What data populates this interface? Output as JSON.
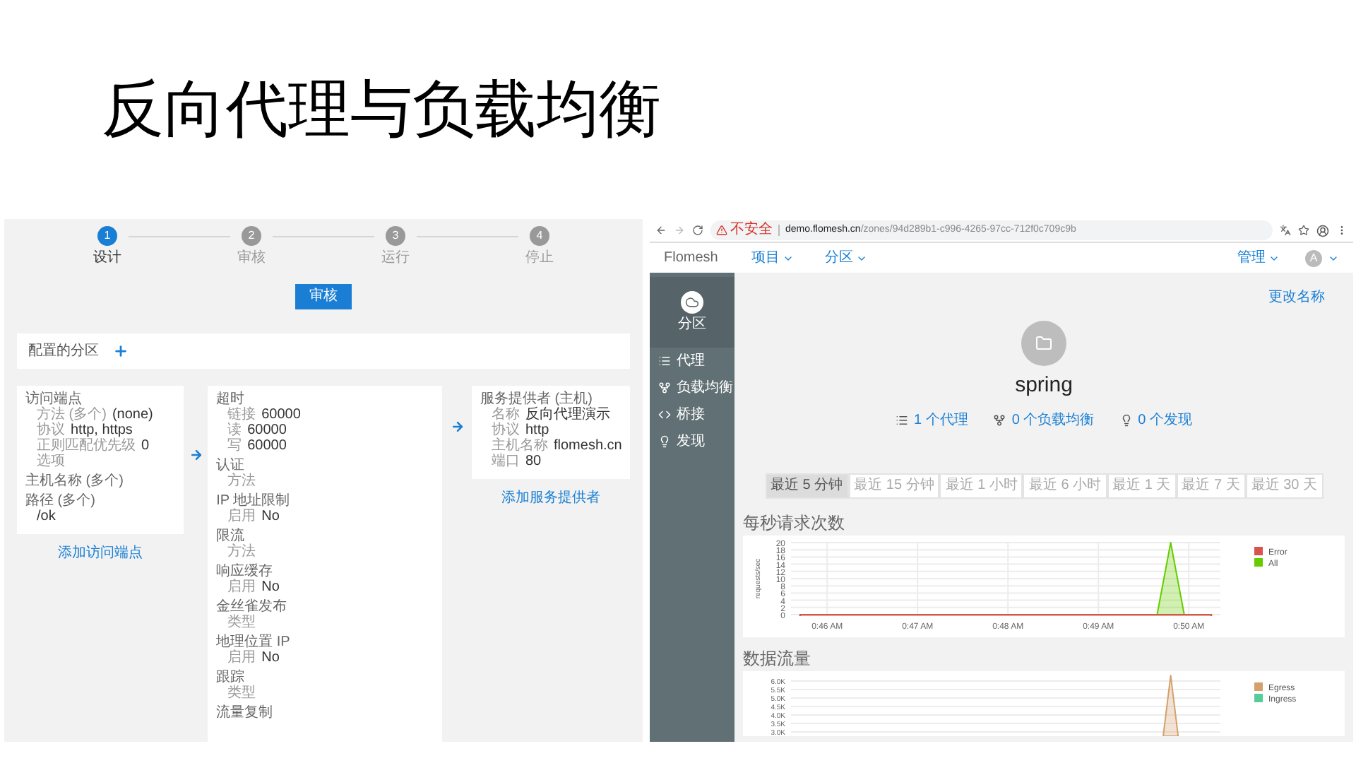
{
  "slide_title": "反向代理与负载均衡",
  "designer": {
    "steps": [
      {
        "number": "1",
        "label": "设计",
        "selected": true
      },
      {
        "number": "2",
        "label": "审核",
        "selected": false
      },
      {
        "number": "3",
        "label": "运行",
        "selected": false
      },
      {
        "number": "4",
        "label": "停止",
        "selected": false
      }
    ],
    "submit_button": "审核",
    "partition_bar": {
      "label": "配置的分区"
    },
    "entry_card": {
      "sections": [
        {
          "title": "访问端点",
          "rows": [
            {
              "label": "方法 (多个)",
              "value": "(none)"
            },
            {
              "label": "协议",
              "value": "http, https"
            },
            {
              "label": "正则匹配优先级",
              "value": "0"
            },
            {
              "label": "选项"
            }
          ]
        },
        {
          "title": "主机名称 (多个)"
        },
        {
          "title": "路径 (多个)",
          "rows": [
            {
              "value": "/ok"
            }
          ]
        }
      ]
    },
    "add_entry_link": "添加访问端点",
    "policy_card": {
      "sections": [
        {
          "title": "超时",
          "rows": [
            {
              "label": "链接",
              "value": "60000"
            },
            {
              "label": "读",
              "value": "60000"
            },
            {
              "label": "写",
              "value": "60000"
            }
          ]
        },
        {
          "title": "认证",
          "rows": [
            {
              "label": "方法"
            }
          ]
        },
        {
          "title": "IP 地址限制",
          "rows": [
            {
              "label": "启用",
              "value": "No"
            }
          ]
        },
        {
          "title": "限流",
          "rows": [
            {
              "label": "方法"
            }
          ]
        },
        {
          "title": "响应缓存",
          "rows": [
            {
              "label": "启用",
              "value": "No"
            }
          ]
        },
        {
          "title": "金丝雀发布",
          "rows": [
            {
              "label": "类型"
            }
          ]
        },
        {
          "title": "地理位置 IP",
          "rows": [
            {
              "label": "启用",
              "value": "No"
            }
          ]
        },
        {
          "title": "跟踪",
          "rows": [
            {
              "label": "类型"
            }
          ]
        },
        {
          "title": "流量复制"
        }
      ]
    },
    "provider_card": {
      "sections": [
        {
          "title": "服务提供者 (主机)",
          "rows": [
            {
              "label": "名称",
              "value": "反向代理演示"
            },
            {
              "label": "协议",
              "value": "http"
            },
            {
              "label": "主机名称",
              "value": "flomesh.cn"
            },
            {
              "label": "端口",
              "value": "80"
            }
          ]
        }
      ]
    },
    "add_provider_link": "添加服务提供者"
  },
  "browser": {
    "address_bar": {
      "security_label": "不安全",
      "host": "demo.flomesh.cn",
      "path": "/zones/94d289b1-c996-4265-97cc-712f0c709c9b"
    },
    "navbar": {
      "brand": "Flomesh",
      "menus": [
        "项目",
        "分区"
      ],
      "admin_menu": "管理",
      "avatar": "A"
    },
    "sidebar": {
      "header": "分区",
      "items": [
        "代理",
        "负载均衡",
        "桥接",
        "发现"
      ]
    },
    "rename_link": "更改名称",
    "zone_name": "spring",
    "stats": [
      "1 个代理",
      "0 个负载均衡",
      "0 个发现"
    ],
    "time_ranges": [
      {
        "label": "最近 5 分钟",
        "selected": true
      },
      {
        "label": "最近 15 分钟",
        "selected": false
      },
      {
        "label": "最近 1 小时",
        "selected": false
      },
      {
        "label": "最近 6 小时",
        "selected": false
      },
      {
        "label": "最近 1 天",
        "selected": false
      },
      {
        "label": "最近 7 天",
        "selected": false
      },
      {
        "label": "最近 30 天",
        "selected": false
      }
    ],
    "requests_panel": {
      "title": "每秒请求次数",
      "chart_data": {
        "type": "area",
        "grid": true,
        "legend": true,
        "ylabel": "requests/sec",
        "x": [
          45.7,
          46,
          46.5,
          47,
          47.5,
          48,
          48.5,
          49,
          49.5,
          49.65,
          49.8,
          49.95,
          50.25
        ],
        "series": [
          {
            "name": "Error",
            "color": "#d9534f",
            "values": [
              0,
              0,
              0,
              0,
              0,
              0,
              0,
              0,
              0,
              0,
              0,
              0,
              0
            ]
          },
          {
            "name": "All",
            "color": "#66cc00",
            "values": [
              0,
              0,
              0,
              0,
              0,
              0,
              0,
              0,
              0,
              0,
              20,
              0,
              0
            ]
          }
        ],
        "xlim": [
          45.6,
          50.35
        ],
        "ylim": [
          0,
          20
        ],
        "xticks": [
          {
            "value": 46,
            "label": "0:46 AM"
          },
          {
            "value": 47,
            "label": "0:47 AM"
          },
          {
            "value": 48,
            "label": "0:48 AM"
          },
          {
            "value": 49,
            "label": "0:49 AM"
          },
          {
            "value": 50,
            "label": "0:50 AM"
          }
        ],
        "yticks": [
          0,
          2,
          4,
          6,
          8,
          10,
          12,
          14,
          16,
          18,
          20
        ]
      }
    },
    "traffic_panel": {
      "title": "数据流量",
      "y_axis_labels": [
        "6.0K",
        "5.5K",
        "5.0K",
        "4.5K",
        "4.0K",
        "3.5K",
        "3.0K"
      ],
      "legend": [
        {
          "name": "Egress",
          "color": "#d4a06c"
        },
        {
          "name": "Ingress",
          "color": "#55cc99"
        }
      ]
    }
  }
}
